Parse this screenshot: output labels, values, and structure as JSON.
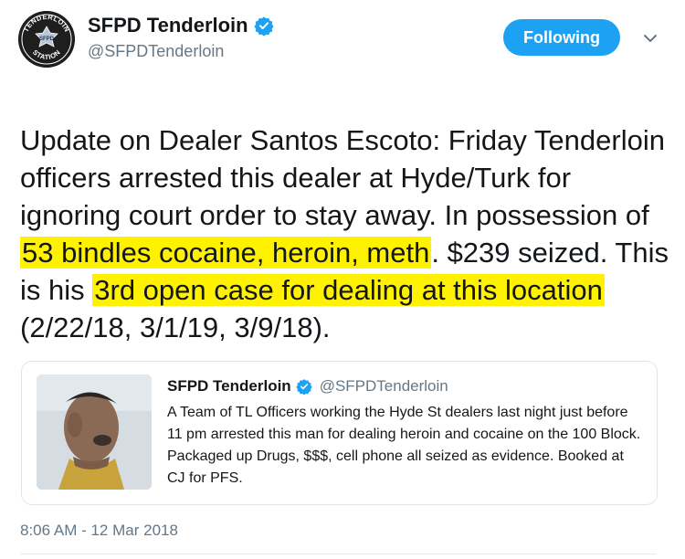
{
  "author": {
    "display_name": "SFPD Tenderloin",
    "handle": "@SFPDTenderloin",
    "avatar_text_top": "TENDERLOIN",
    "avatar_text_center": "SFPD",
    "avatar_text_bottom": "STATION"
  },
  "follow_button": {
    "label": "Following"
  },
  "tweet": {
    "segments": [
      {
        "text": "Update on Dealer Santos Escoto:  Friday Tenderloin officers arrested this dealer at Hyde/Turk for ignoring court order to stay away.  In possession of ",
        "highlight": false
      },
      {
        "text": "53 bindles cocaine, heroin, meth",
        "highlight": true
      },
      {
        "text": ". $239 seized. This is his ",
        "highlight": false
      },
      {
        "text": "3rd open case for dealing at this location",
        "highlight": true
      },
      {
        "text": " (2/22/18, 3/1/19, 3/9/18).",
        "highlight": false
      }
    ],
    "timestamp": "8:06 AM - 12 Mar 2018"
  },
  "quoted_tweet": {
    "display_name": "SFPD Tenderloin",
    "handle": "@SFPDTenderloin",
    "text": "A Team of TL Officers working the Hyde St dealers last night just before 11 pm arrested this man for dealing heroin and cocaine on the 100 Block.  Packaged up Drugs, $$$, cell phone all seized as evidence.   Booked at CJ for PFS."
  },
  "colors": {
    "accent": "#1da1f2",
    "highlight": "#fff200",
    "secondary_text": "#657786"
  },
  "icons": {
    "verified": "verified-badge-icon",
    "chevron": "chevron-down-icon"
  }
}
